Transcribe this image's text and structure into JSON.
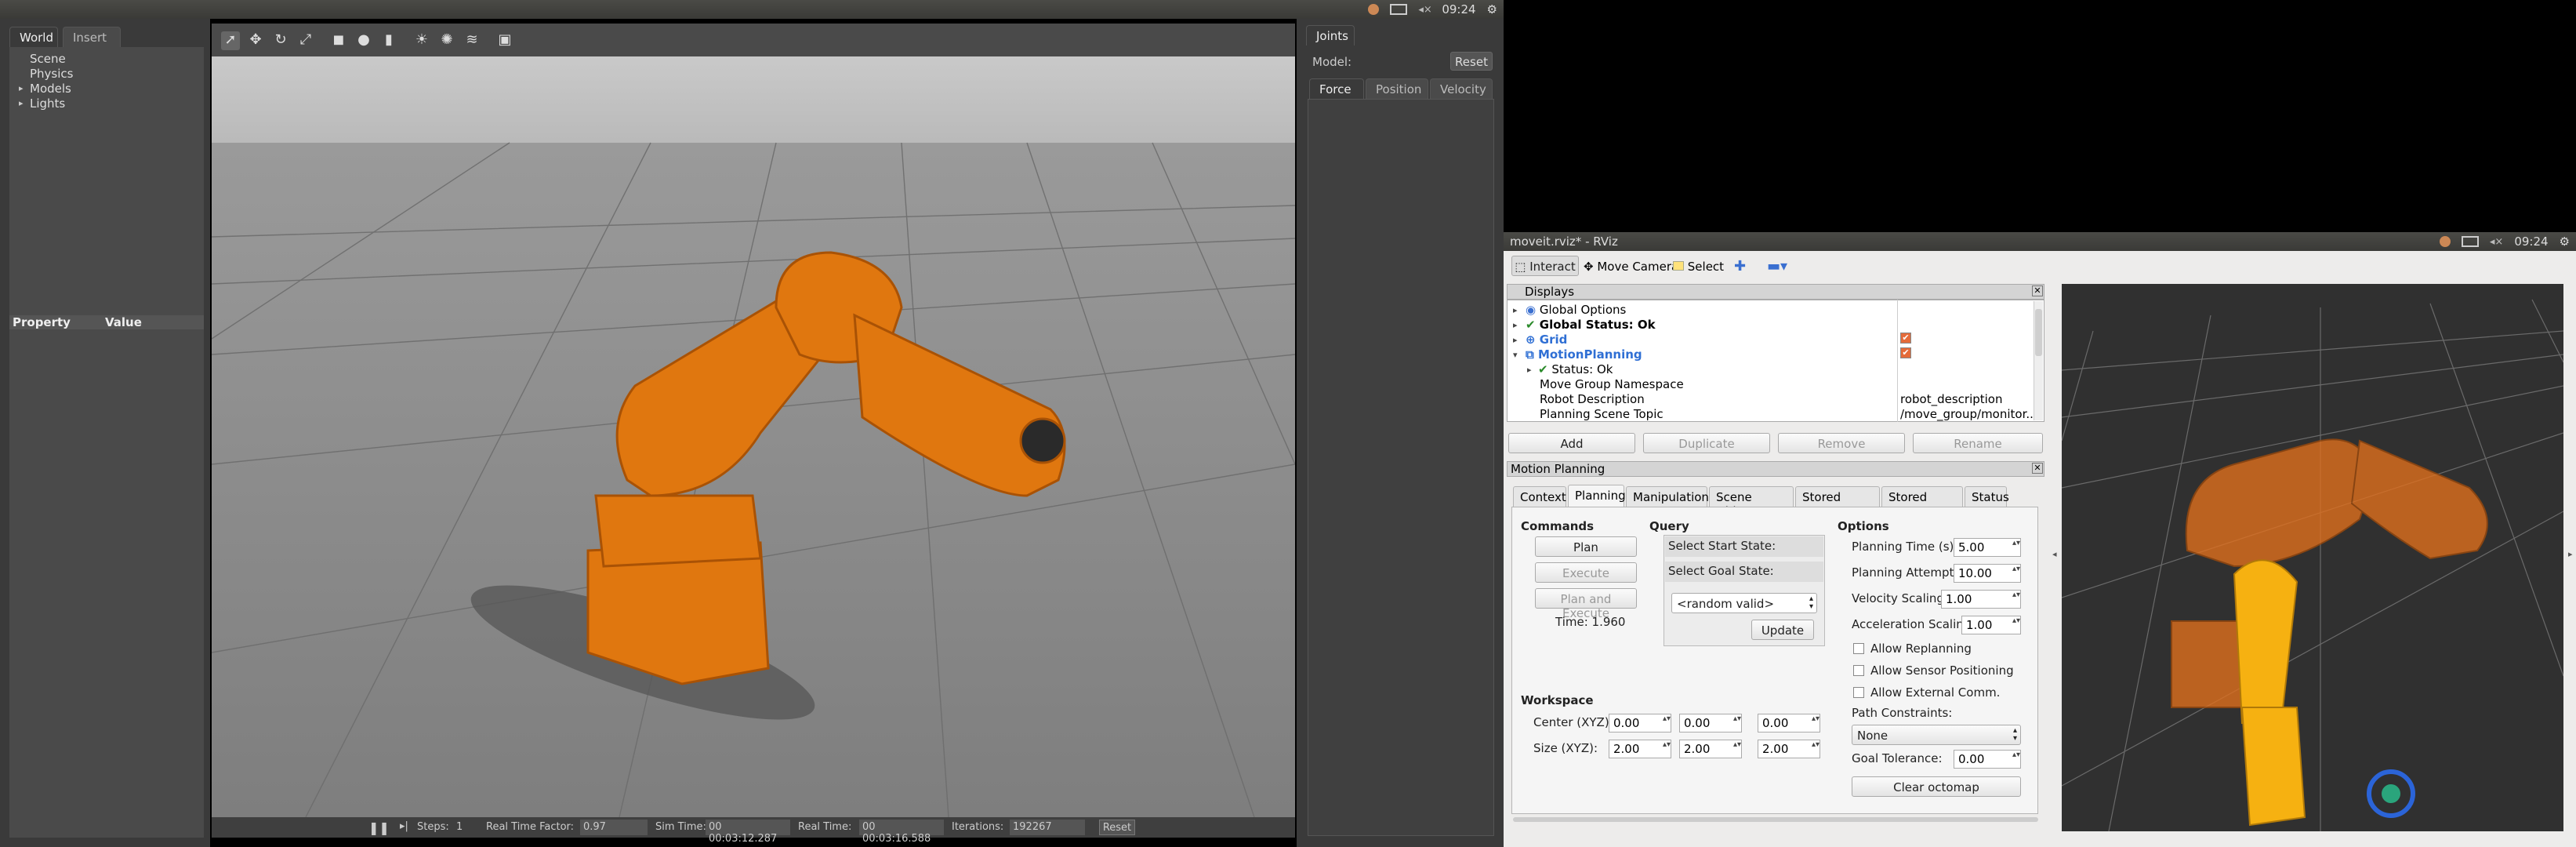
{
  "gazebo": {
    "clock": "09:24",
    "left_tabs": [
      "World",
      "Insert"
    ],
    "tree": [
      "Scene",
      "Physics",
      "Models",
      "Lights"
    ],
    "prop_headers": [
      "Property",
      "Value"
    ],
    "right_tab": "Joints",
    "model_label": "Model:",
    "reset_label": "Reset",
    "joint_tabs": [
      "Force",
      "Position",
      "Velocity"
    ],
    "bottom": {
      "steps_label": "Steps:",
      "steps_value": "1",
      "rtf_label": "Real Time Factor:",
      "rtf_value": "0.97",
      "sim_label": "Sim Time:",
      "sim_value": "00 00:03:12.287",
      "real_label": "Real Time:",
      "real_value": "00 00:03:16.588",
      "iter_label": "Iterations:",
      "iter_value": "192267",
      "reset": "Reset"
    }
  },
  "rviz": {
    "title": "moveit.rviz* - RViz",
    "clock": "09:24",
    "toolbar": [
      "Interact",
      "Move Camera",
      "Select"
    ],
    "displays_title": "Displays",
    "displays": [
      {
        "name": "Global Options",
        "value": ""
      },
      {
        "name": "Global Status: Ok",
        "value": ""
      },
      {
        "name": "Grid",
        "value": ""
      },
      {
        "name": "MotionPlanning",
        "value": ""
      },
      {
        "name": "Status: Ok",
        "value": ""
      },
      {
        "name": "Move Group Namespace",
        "value": ""
      },
      {
        "name": "Robot Description",
        "value": "robot_description"
      },
      {
        "name": "Planning Scene Topic",
        "value": "/move_group/monitor..."
      }
    ],
    "display_buttons": [
      "Add",
      "Duplicate",
      "Remove",
      "Rename"
    ],
    "mp_title": "Motion Planning",
    "mp_tabs": [
      "Context",
      "Planning",
      "Manipulation",
      "Scene Objects",
      "Stored Scenes",
      "Stored States",
      "Status"
    ],
    "commands": {
      "title": "Commands",
      "plan": "Plan",
      "execute": "Execute",
      "plan_execute": "Plan and Execute",
      "time": "Time: 1.960"
    },
    "query": {
      "title": "Query",
      "start": "Select Start State:",
      "goal": "Select Goal State:",
      "select": "<random valid>",
      "update": "Update"
    },
    "options": {
      "title": "Options",
      "planning_time_label": "Planning Time (s):",
      "planning_time": "5.00",
      "attempts_label": "Planning Attempts:",
      "attempts": "10.00",
      "vel_label": "Velocity Scaling:",
      "vel": "1.00",
      "acc_label": "Acceleration Scaling:",
      "acc": "1.00",
      "replan": "Allow Replanning",
      "sensor": "Allow Sensor Positioning",
      "external": "Allow External Comm.",
      "constraints_label": "Path Constraints:",
      "constraints": "None",
      "tol_label": "Goal Tolerance:",
      "tol": "0.00",
      "clear": "Clear octomap"
    },
    "workspace": {
      "title": "Workspace",
      "center_label": "Center (XYZ):",
      "center": [
        "0.00",
        "0.00",
        "0.00"
      ],
      "size_label": "Size (XYZ):",
      "size": [
        "2.00",
        "2.00",
        "2.00"
      ]
    }
  }
}
